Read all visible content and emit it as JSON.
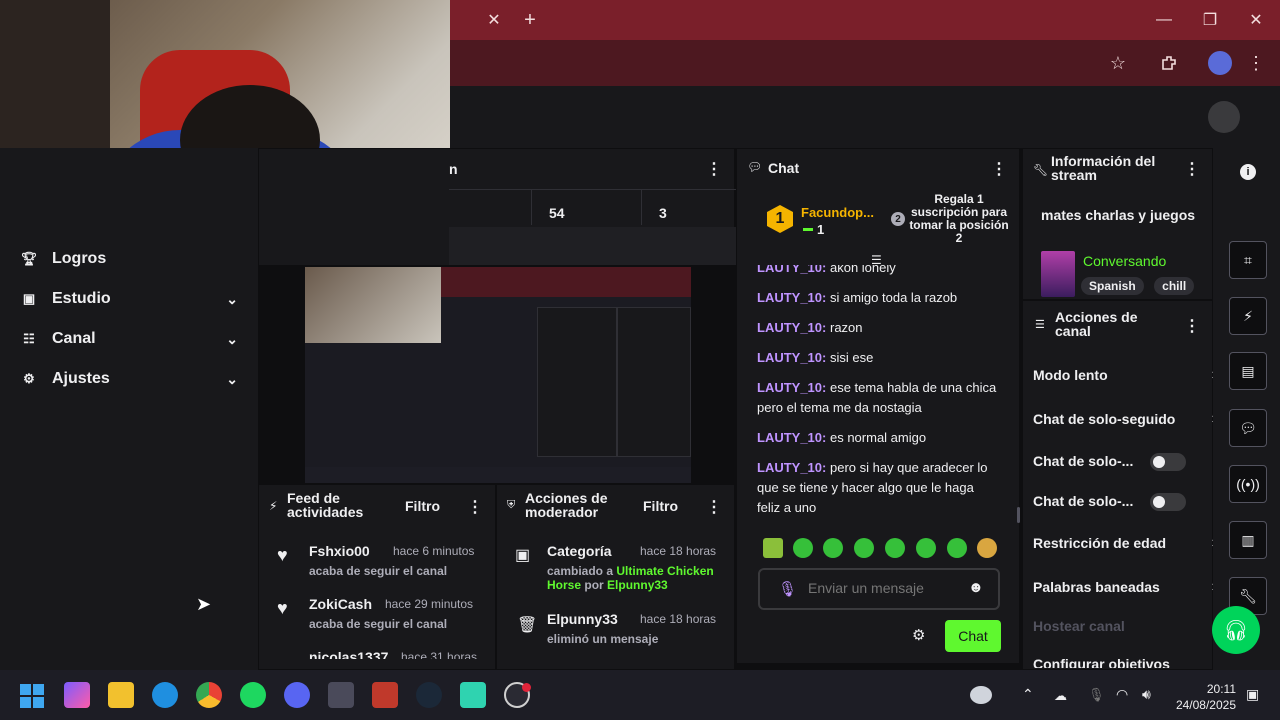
{
  "browser": {
    "tab_close": "✕",
    "new_tab": "+",
    "win_min": "—",
    "win_max": "❐",
    "win_close": "✕"
  },
  "stats_row": {
    "values": [
      "54",
      "3"
    ],
    "title_fragment": "n"
  },
  "sidenav": {
    "items": [
      {
        "label": "Logros",
        "icon": "trophy-icon"
      },
      {
        "label": "Estudio",
        "icon": "studio-icon"
      },
      {
        "label": "Canal",
        "icon": "channel-icon"
      },
      {
        "label": "Ajustes",
        "icon": "gear-icon"
      }
    ]
  },
  "activity_feed": {
    "title": "Feed de actividades",
    "filter": "Filtro",
    "items": [
      {
        "user": "Fshxio00",
        "time": "hace 6 minutos",
        "action": "acaba de seguir el canal"
      },
      {
        "user": "ZokiCash",
        "time": "hace 29 minutos",
        "action": "acaba de seguir el canal"
      },
      {
        "user": "nicolas1337",
        "time": "hace 31 horas",
        "action": ""
      }
    ]
  },
  "mod_actions": {
    "title": "Acciones de moderador",
    "filter": "Filtro",
    "items": [
      {
        "user": "Categoría",
        "time": "hace 18 horas",
        "line1": "cambiado a",
        "game": "Ultimate Chicken Horse",
        "by": "por",
        "mod": "Elpunny33"
      },
      {
        "user": "Elpunny33",
        "time": "hace 18 horas",
        "line1": "eliminó un mensaje"
      }
    ]
  },
  "chat": {
    "title": "Chat",
    "leader": {
      "rank": "1",
      "name": "Facundop...",
      "count": "1"
    },
    "gift": {
      "rank": "2",
      "text": "Regala 1 suscripción para tomar la posición 2"
    },
    "messages": [
      {
        "user": "LAUTY_10:",
        "text": "akon lonely"
      },
      {
        "user": "LAUTY_10:",
        "text": "si amigo toda la razob"
      },
      {
        "user": "LAUTY_10:",
        "text": "razon"
      },
      {
        "user": "LAUTY_10:",
        "text": "sisi ese"
      },
      {
        "user": "LAUTY_10:",
        "text": "ese tema habla de una chica pero el tema me da nostagia"
      },
      {
        "user": "LAUTY_10:",
        "text": "es normal amigo"
      },
      {
        "user": "LAUTY_10:",
        "text": "pero si hay que aradecer lo que se tiene y hacer algo que le haga feliz a uno"
      }
    ],
    "placeholder": "Enviar un mensaje",
    "send": "Chat"
  },
  "stream_info": {
    "title": "Información del stream",
    "stream_title": "mates charlas y juegos",
    "category": "Conversando",
    "tags": [
      "Spanish",
      "chill"
    ]
  },
  "channel_actions": {
    "title": "Acciones de canal",
    "items": [
      {
        "label": "Modo lento",
        "type": "chevron"
      },
      {
        "label": "Chat de solo-seguido",
        "type": "chevron"
      },
      {
        "label": "Chat de solo-...",
        "type": "toggle"
      },
      {
        "label": "Chat de solo-...",
        "type": "toggle"
      },
      {
        "label": "Restricción de edad",
        "type": "chevron"
      },
      {
        "label": "Palabras baneadas",
        "type": "chevron"
      },
      {
        "label": "Hostear canal",
        "type": "disabled"
      },
      {
        "label": "Configurar objetivos",
        "type": "chevron"
      }
    ]
  },
  "taskbar": {
    "time": "20:11",
    "date": "24/08/2025"
  },
  "colors": {
    "accent": "#bf94ff",
    "green": "#00f593",
    "send_green": "#5ff82f",
    "tab_red": "#7a1f2a"
  }
}
